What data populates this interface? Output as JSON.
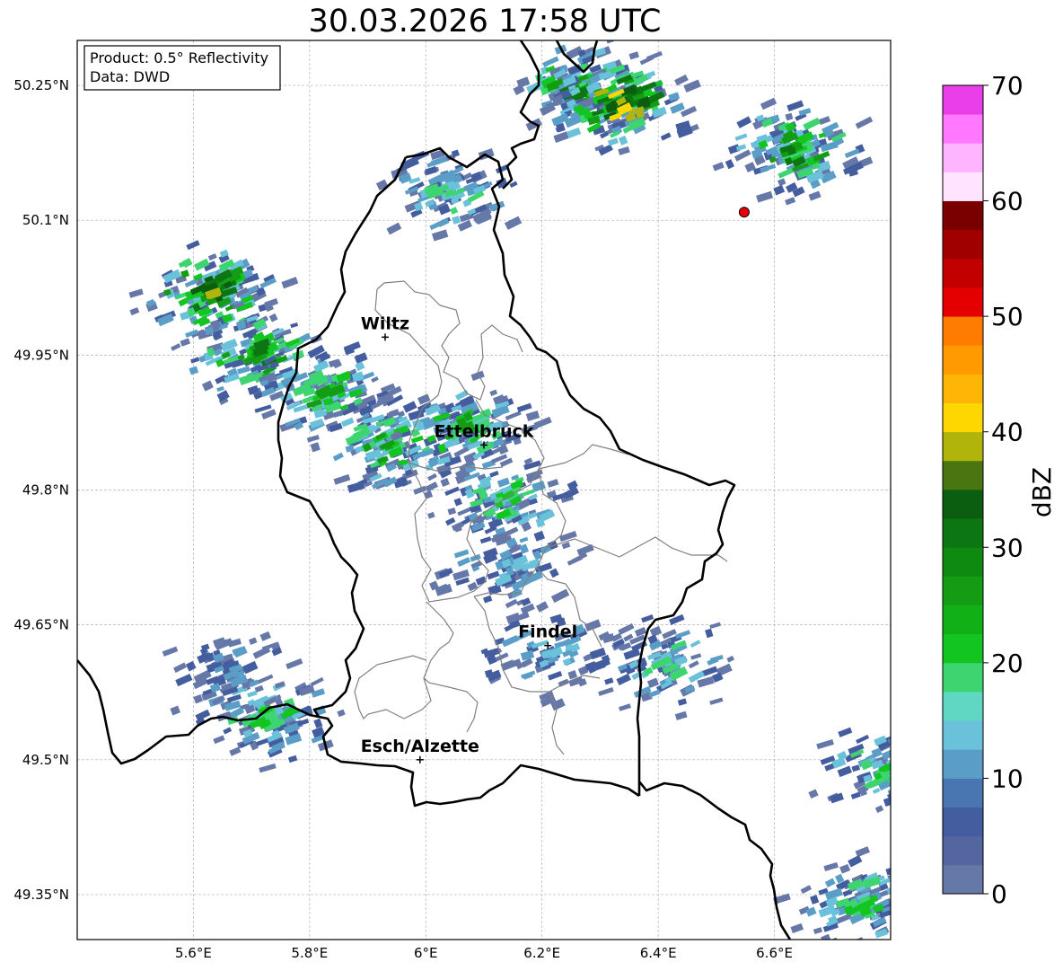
{
  "title": "30.03.2026 17:58 UTC",
  "info_box": {
    "product": "Product: 0.5° Reflectivity",
    "data": "Data: DWD"
  },
  "map": {
    "lon_range": [
      5.4,
      6.8
    ],
    "lat_range": [
      49.3,
      50.3
    ],
    "grid": true,
    "lon_ticks": [
      {
        "value": 5.6,
        "label": "5.6°E"
      },
      {
        "value": 5.8,
        "label": "5.8°E"
      },
      {
        "value": 6.0,
        "label": "6°E"
      },
      {
        "value": 6.2,
        "label": "6.2°E"
      },
      {
        "value": 6.4,
        "label": "6.4°E"
      },
      {
        "value": 6.6,
        "label": "6.6°E"
      }
    ],
    "lat_ticks": [
      {
        "value": 50.25,
        "label": "50.25°N"
      },
      {
        "value": 50.1,
        "label": "50.1°N"
      },
      {
        "value": 49.95,
        "label": "49.95°N"
      },
      {
        "value": 49.8,
        "label": "49.8°N"
      },
      {
        "value": 49.65,
        "label": "49.65°N"
      },
      {
        "value": 49.5,
        "label": "49.5°N"
      },
      {
        "value": 49.35,
        "label": "49.35°N"
      }
    ],
    "cities": [
      {
        "name": "Wiltz",
        "lon": 5.93,
        "lat": 49.97
      },
      {
        "name": "Ettelbruck",
        "lon": 6.1,
        "lat": 49.85
      },
      {
        "name": "Findel",
        "lon": 6.21,
        "lat": 49.627
      },
      {
        "name": "Esch/Alzette",
        "lon": 5.99,
        "lat": 49.5
      }
    ],
    "radar_site": {
      "lon": 6.548,
      "lat": 50.109,
      "color": "#e8000b"
    }
  },
  "colorbar": {
    "label": "dBZ",
    "min": 0,
    "max": 70,
    "step": 2.5,
    "tick_labels": [
      "0",
      "10",
      "20",
      "30",
      "40",
      "50",
      "60",
      "70"
    ],
    "colors": [
      "#6678a8",
      "#5366a0",
      "#445d9f",
      "#4976b0",
      "#5a9ec8",
      "#69c2da",
      "#5fd7c3",
      "#3dd56f",
      "#12c520",
      "#12b017",
      "#139c14",
      "#0f8a11",
      "#0c7612",
      "#0b5e10",
      "#4a7611",
      "#b0b40b",
      "#ffd700",
      "#ffb506",
      "#ff9b00",
      "#ff7c00",
      "#e40000",
      "#c30000",
      "#a00000",
      "#7a0000",
      "#ffe3ff",
      "#ffb4ff",
      "#ff78ff",
      "#e93ee9"
    ]
  },
  "chart_data": {
    "type": "heatmap",
    "title": "30.03.2026 17:58 UTC",
    "variable": "0.5° Reflectivity (dBZ)",
    "source": "DWD",
    "echo_cells": [
      {
        "lon": 5.62,
        "lat": 50.02,
        "max_dbz": 40
      },
      {
        "lon": 5.7,
        "lat": 49.95,
        "max_dbz": 30
      },
      {
        "lon": 5.82,
        "lat": 49.91,
        "max_dbz": 27
      },
      {
        "lon": 5.93,
        "lat": 49.85,
        "max_dbz": 28
      },
      {
        "lon": 6.05,
        "lat": 49.87,
        "max_dbz": 26
      },
      {
        "lon": 6.13,
        "lat": 49.79,
        "max_dbz": 22
      },
      {
        "lon": 6.13,
        "lat": 49.72,
        "max_dbz": 15
      },
      {
        "lon": 6.25,
        "lat": 50.25,
        "max_dbz": 30
      },
      {
        "lon": 6.32,
        "lat": 50.23,
        "max_dbz": 42
      },
      {
        "lon": 6.62,
        "lat": 50.18,
        "max_dbz": 30
      },
      {
        "lon": 5.72,
        "lat": 49.55,
        "max_dbz": 25
      },
      {
        "lon": 5.65,
        "lat": 49.6,
        "max_dbz": 12
      },
      {
        "lon": 6.4,
        "lat": 49.61,
        "max_dbz": 21
      },
      {
        "lon": 6.78,
        "lat": 49.49,
        "max_dbz": 23
      },
      {
        "lon": 6.74,
        "lat": 49.34,
        "max_dbz": 22
      },
      {
        "lon": 6.03,
        "lat": 50.13,
        "max_dbz": 20
      },
      {
        "lon": 6.2,
        "lat": 49.62,
        "max_dbz": 14
      }
    ]
  }
}
